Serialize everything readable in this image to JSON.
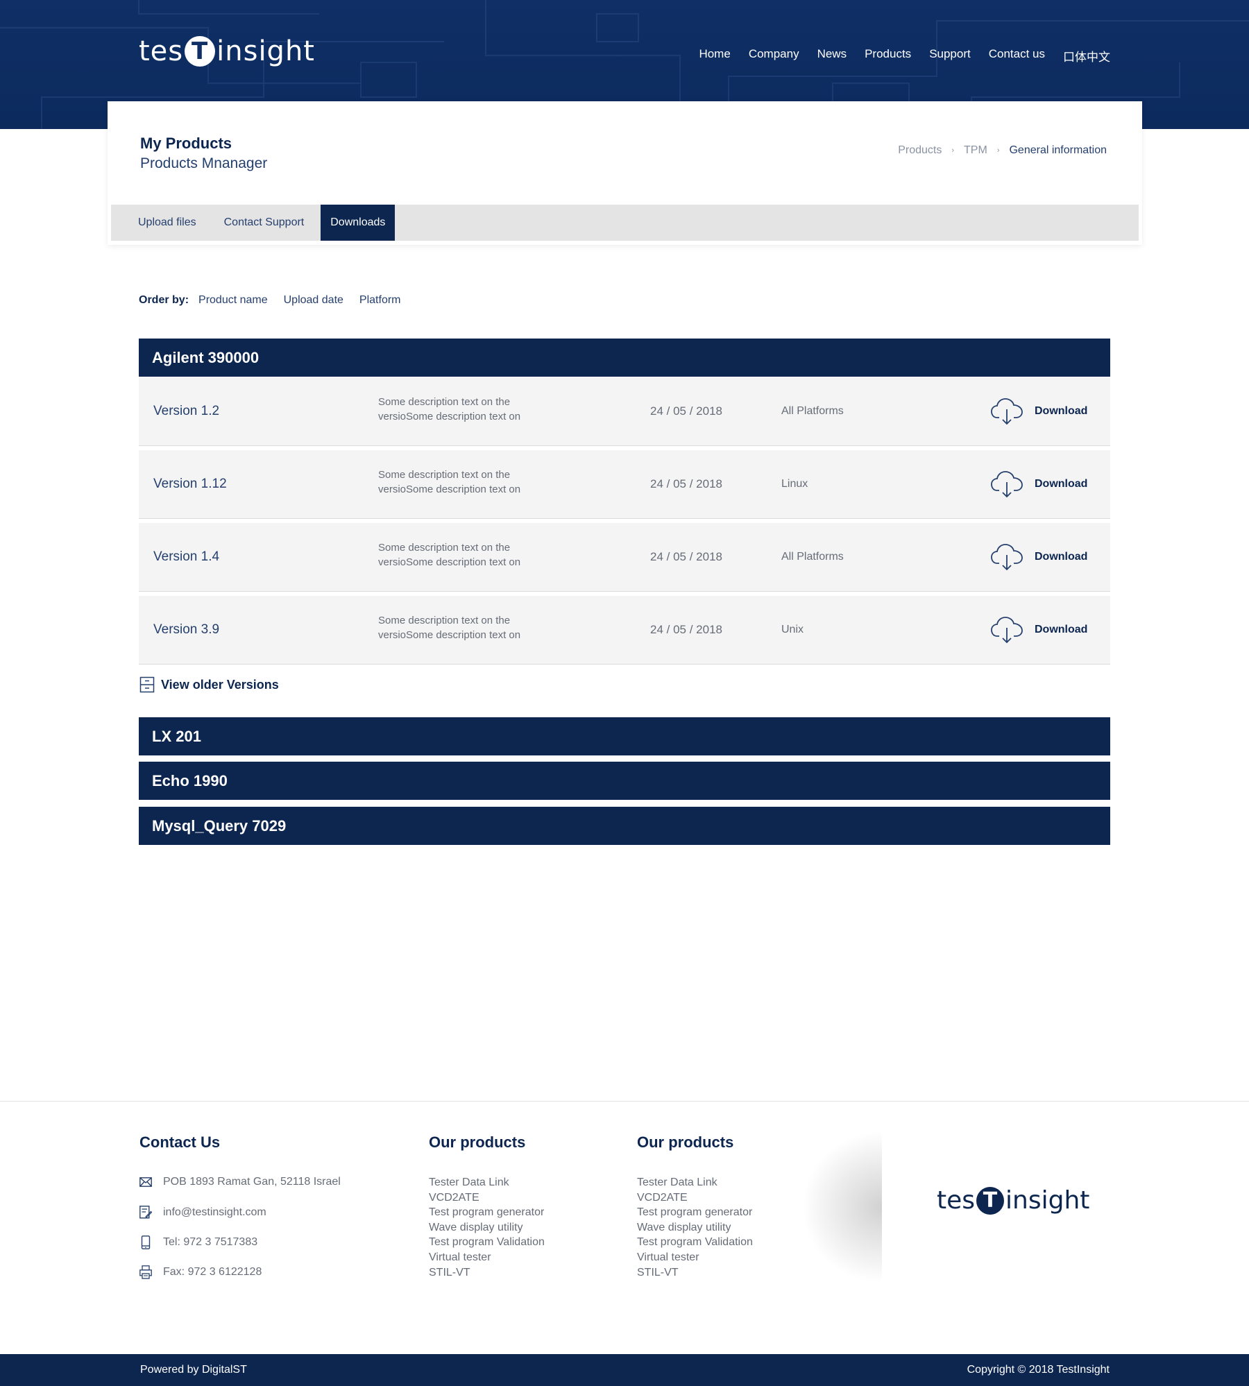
{
  "header": {
    "logo_left": "tes",
    "logo_badge": "T",
    "logo_right": "insight",
    "nav": [
      "Home",
      "Company",
      "News",
      "Products",
      "Support",
      "Contact us",
      "口体中文"
    ]
  },
  "page": {
    "title": "My Products",
    "subtitle": "Products Mnanager",
    "breadcrumb": [
      "Products",
      "TPM",
      "General information"
    ],
    "breadcrumb_sep": "›",
    "tabs": [
      "Upload files",
      "Contact Support",
      "Downloads"
    ],
    "active_tab": "Downloads"
  },
  "order_by": {
    "label": "Order by:",
    "options": [
      "Product name",
      "Upload date",
      "Platform"
    ]
  },
  "products": [
    {
      "name": "Agilent 390000",
      "versions": [
        {
          "version": "Version 1.2",
          "description": "Some description text on the versioSome description text on",
          "date": "24 / 05 / 2018",
          "platform": "All Platforms",
          "action": "Download"
        },
        {
          "version": "Version 1.12",
          "description": "Some description text on the versioSome description text on",
          "date": "24 / 05 / 2018",
          "platform": "Linux",
          "action": "Download"
        },
        {
          "version": "Version 1.4",
          "description": "Some description text on the versioSome description text on",
          "date": "24 / 05 / 2018",
          "platform": "All Platforms",
          "action": "Download"
        },
        {
          "version": "Version 3.9",
          "description": "Some description text on the versioSome description text on",
          "date": "24 / 05 / 2018",
          "platform": "Unix",
          "action": "Download"
        }
      ],
      "older_label": "View older Versions"
    },
    {
      "name": "LX 201"
    },
    {
      "name": "Echo 1990"
    },
    {
      "name": "Mysql_Query 7029"
    }
  ],
  "footer": {
    "contact_title": "Contact Us",
    "contact": [
      {
        "icon": "envelope-icon",
        "text": "POB 1893 Ramat Gan, 52118 Israel"
      },
      {
        "icon": "edit-mail-icon",
        "text": "info@testinsight.com"
      },
      {
        "icon": "phone-icon",
        "text": "Tel: 972 3 7517383"
      },
      {
        "icon": "fax-icon",
        "text": "Fax: 972 3 6122128"
      }
    ],
    "products_title_1": "Our products",
    "products_1": [
      "Tester Data Link",
      "VCD2ATE",
      "Test program generator",
      "Wave display utility",
      "Test program Validation",
      "Virtual tester",
      "STIL-VT"
    ],
    "products_title_2": "Our products",
    "products_2": [
      "Tester Data Link",
      "VCD2ATE",
      "Test program generator",
      "Wave display utility",
      "Test program Validation",
      "Virtual tester",
      "STIL-VT"
    ],
    "logo_left": "tes",
    "logo_badge": "T",
    "logo_right": "insight",
    "powered_by": "Powered by DigitalST",
    "copyright": "Copyright © 2018 TestInsight"
  },
  "colors": {
    "navy": "#0d2650",
    "header_blue": "#0f2f66",
    "row_bg": "#f4f4f4",
    "tab_bg": "#e4e4e4"
  }
}
